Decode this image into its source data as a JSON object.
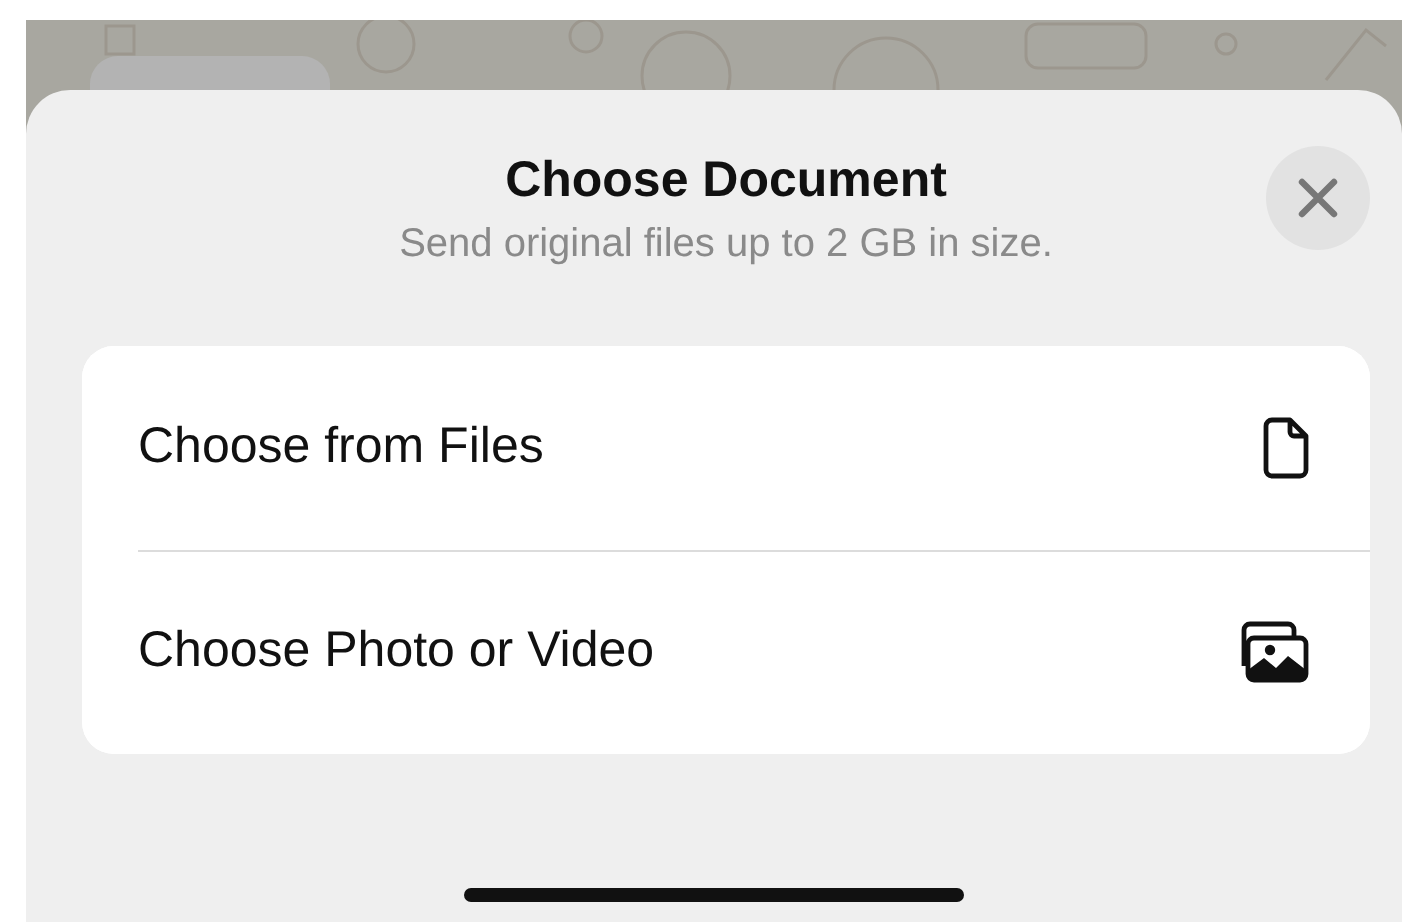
{
  "sheet": {
    "title": "Choose Document",
    "subtitle": "Send original files up to 2 GB in size."
  },
  "options": [
    {
      "label": "Choose from Files",
      "kind": "file"
    },
    {
      "label": "Choose Photo or Video",
      "kind": "photos"
    }
  ]
}
